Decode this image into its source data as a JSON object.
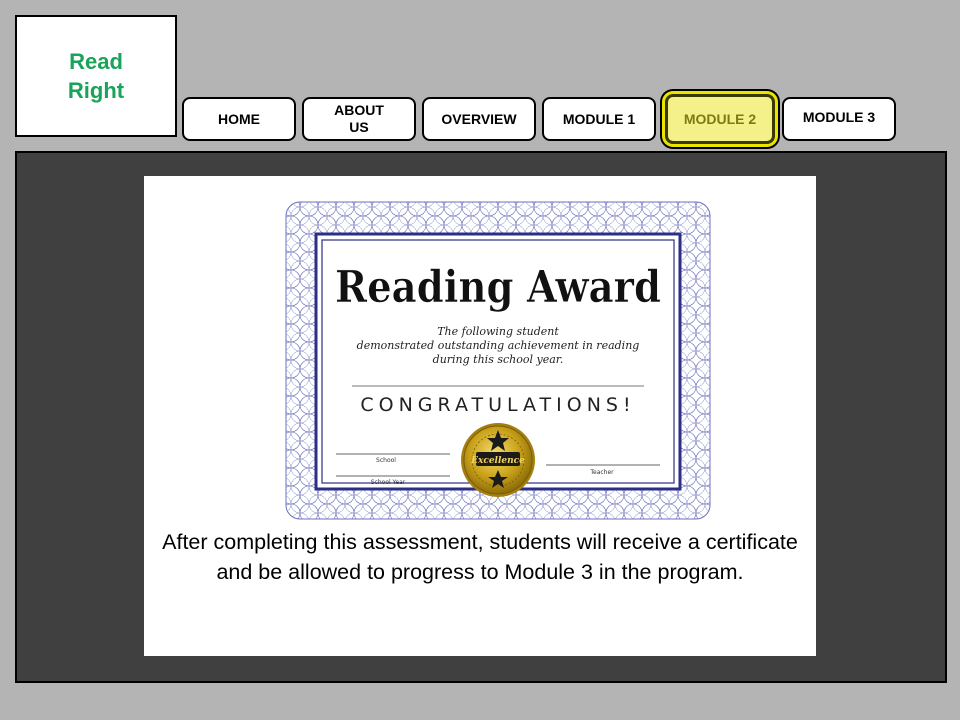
{
  "logo": {
    "line1": "Read",
    "line2": "Right"
  },
  "nav": {
    "items": [
      {
        "id": "home",
        "label": "HOME"
      },
      {
        "id": "about",
        "label_line1": "ABOUT",
        "label_line2": "US"
      },
      {
        "id": "overview",
        "label": "OVERVIEW"
      },
      {
        "id": "module1",
        "label": "MODULE 1"
      },
      {
        "id": "module2",
        "label": "MODULE 2",
        "active": true
      },
      {
        "id": "module3",
        "label": "MODULE 3"
      }
    ]
  },
  "certificate": {
    "title": "Reading Award",
    "subtitle_line1": "The following student",
    "subtitle_line2": "demonstrated outstanding achievement in reading",
    "subtitle_line3": "during this school year.",
    "congrats": "CONGRATULATIONS!",
    "school_label": "School",
    "school_year_label": "School Year",
    "teacher_label": "Teacher",
    "seal_text": "Excellence"
  },
  "caption": "After completing this assessment, students will receive a certificate and be allowed to progress to Module 3 in the program.",
  "colors": {
    "page_bg": "#b4b4b4",
    "panel_bg": "#404040",
    "logo_text": "#1aa35b",
    "active_tab_bg": "#f4f18a",
    "active_tab_glow": "#e9e500",
    "certificate_border": "#2b2f86",
    "seal_gold": "#c9a21a"
  }
}
